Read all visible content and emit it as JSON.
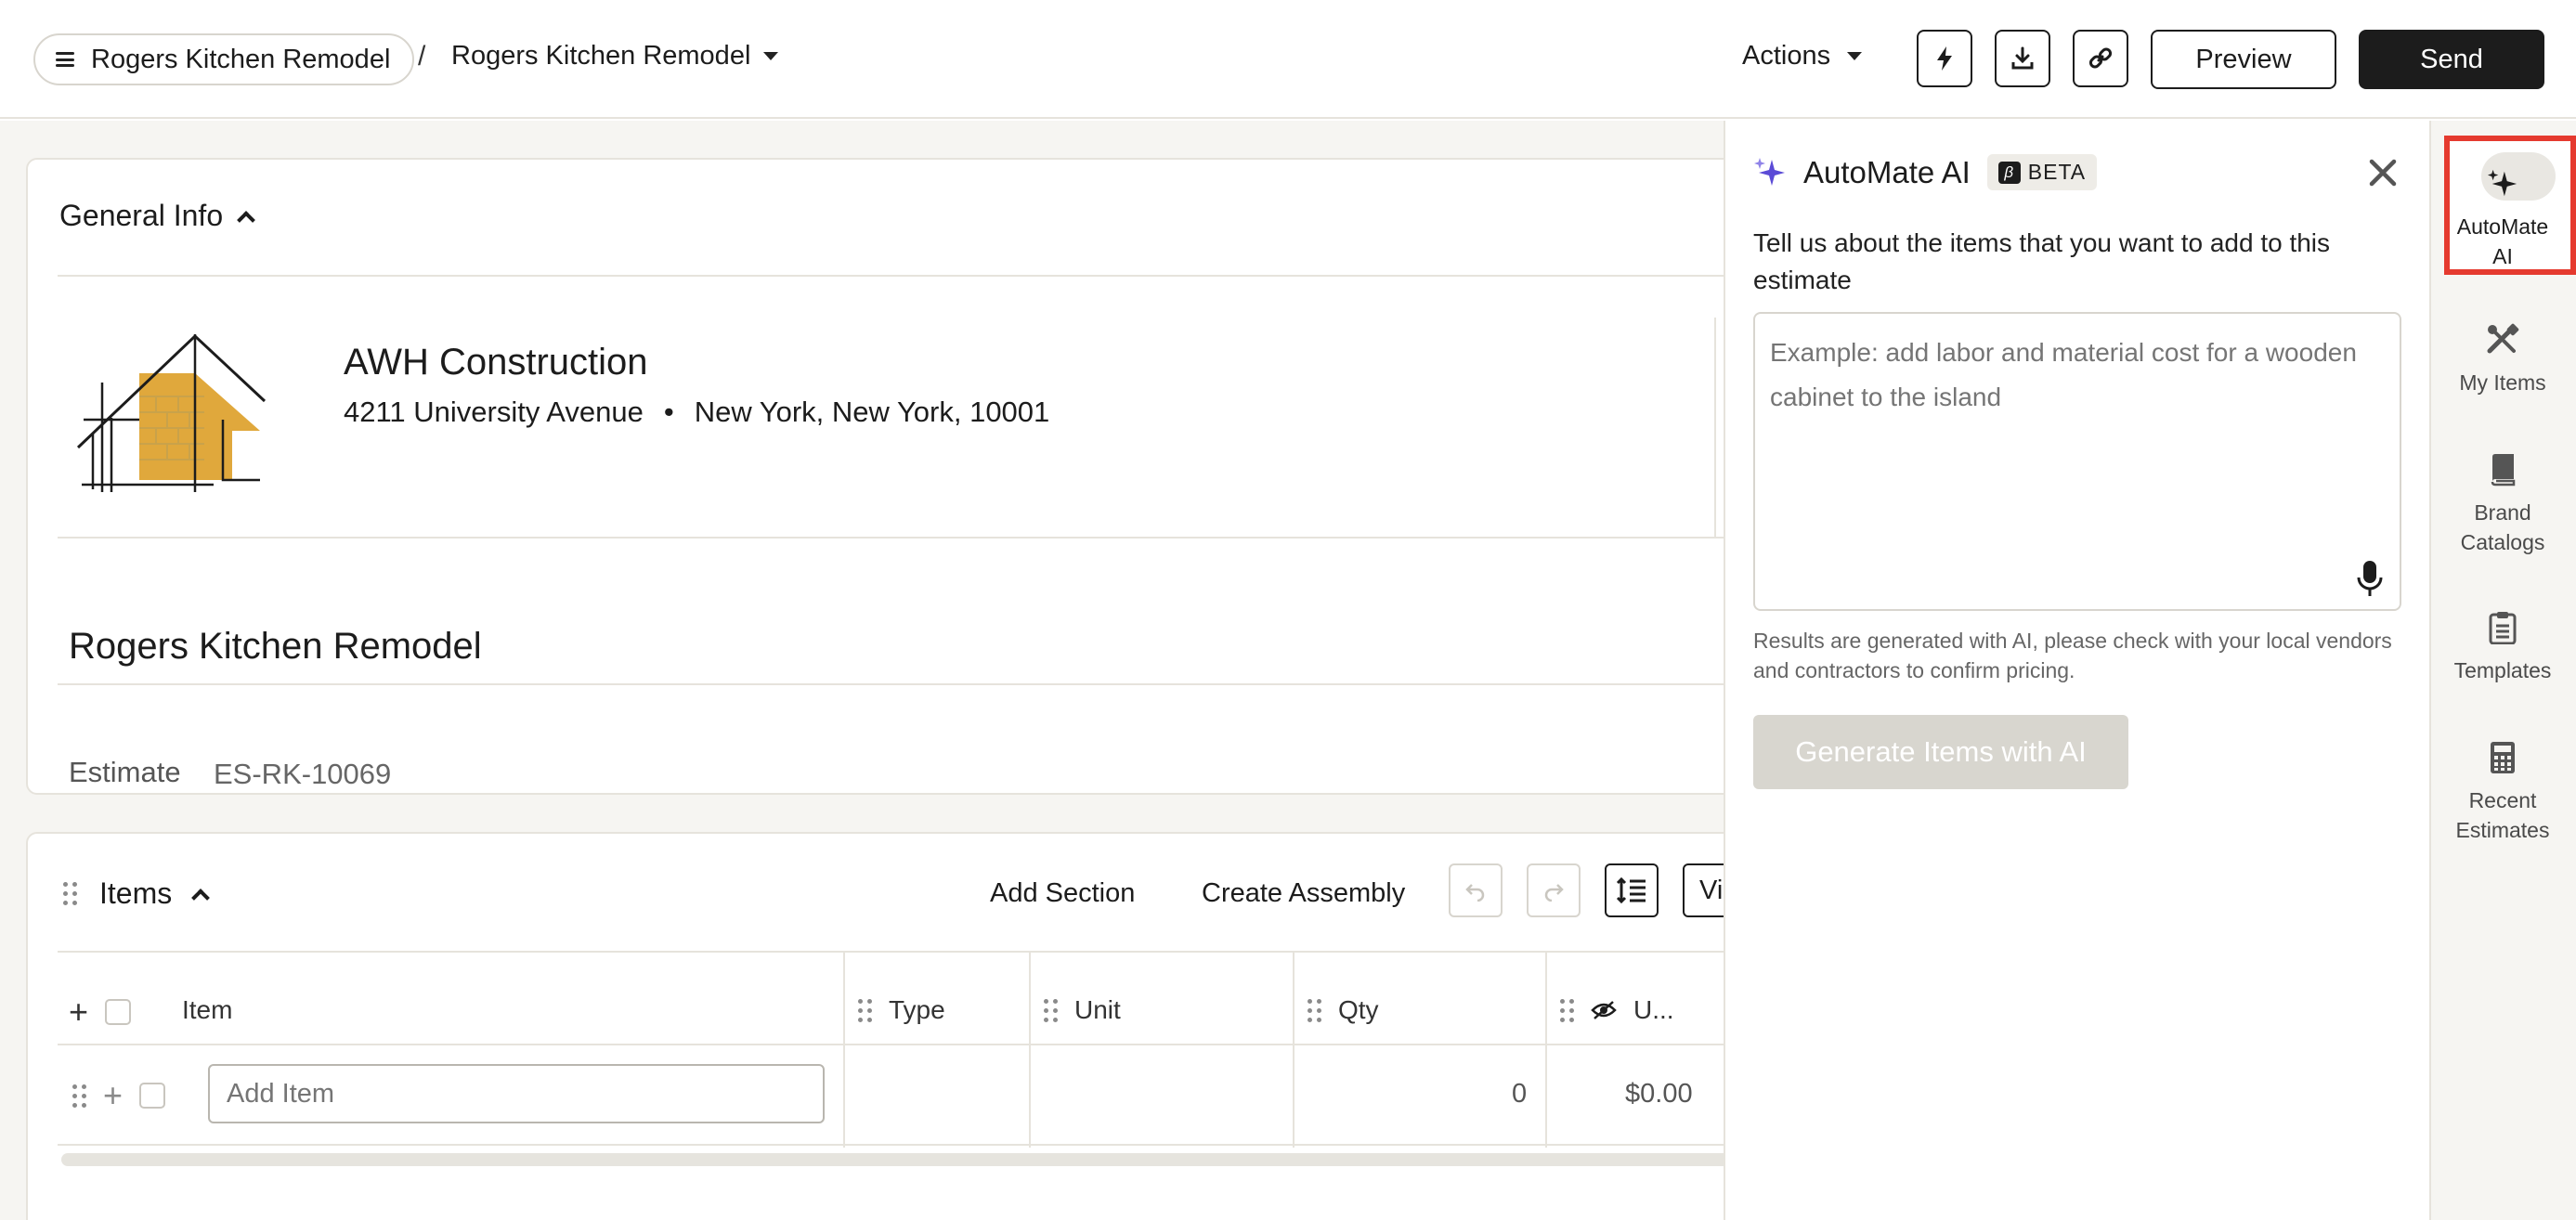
{
  "header": {
    "breadcrumb_root": "Rogers Kitchen Remodel",
    "breadcrumb_separator": "/",
    "breadcrumb_current": "Rogers Kitchen Remodel",
    "actions_label": "Actions",
    "preview_label": "Preview",
    "send_label": "Send"
  },
  "general_info": {
    "title": "General Info",
    "company_name": "AWH Construction",
    "address_street": "4211 University Avenue",
    "address_bullet": "•",
    "address_city": "New York, New York, 10001",
    "project_title": "Rogers Kitchen Remodel",
    "estimate_label": "Estimate",
    "estimate_number": "ES-RK-10069"
  },
  "items": {
    "title": "Items",
    "add_section_label": "Add Section",
    "create_assembly_label": "Create Assembly",
    "view_label": "Vi",
    "columns": [
      "Item",
      "Type",
      "Unit",
      "Qty",
      "U..."
    ],
    "add_item_placeholder": "Add Item",
    "row_qty": "0",
    "row_unit_cost": "$0.00"
  },
  "ai_panel": {
    "title": "AutoMate AI",
    "badge": "BETA",
    "badge_letter": "β",
    "prompt": "Tell us about the items that you want to add to this estimate",
    "placeholder": "Example: add labor and material cost for a wooden cabinet to the island",
    "note": "Results are generated with AI, please check with your local vendors and contractors to confirm pricing.",
    "generate_label": "Generate Items with AI"
  },
  "rail": {
    "items": [
      {
        "label": "AutoMate AI",
        "icon": "sparkle-icon",
        "active": true
      },
      {
        "label": "My Items",
        "icon": "tools-icon"
      },
      {
        "label": "Brand Catalogs",
        "icon": "book-icon"
      },
      {
        "label": "Templates",
        "icon": "clipboard-icon"
      },
      {
        "label": "Recent Estimates",
        "icon": "calculator-icon"
      }
    ]
  },
  "colors": {
    "accent_dark": "#1c1c1c",
    "highlight_red": "#e53a2f",
    "logo_gold": "#e0a83c",
    "sparkle_purple": "#5b4bd6"
  }
}
